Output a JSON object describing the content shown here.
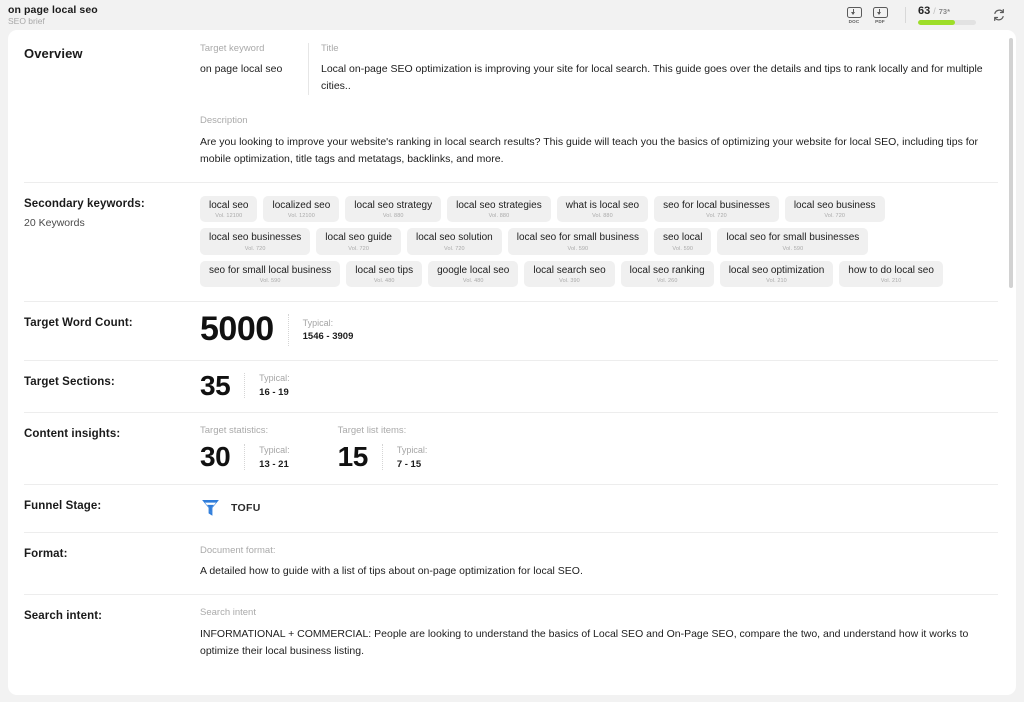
{
  "topbar": {
    "doc_title": "on page local seo",
    "doc_subtitle": "SEO brief",
    "export_doc": {
      "icon": "download-doc-icon",
      "tag": "DOC"
    },
    "export_pdf": {
      "icon": "download-pdf-icon",
      "tag": "PDF"
    },
    "score": {
      "current": "63",
      "separator": "/",
      "max": "73*",
      "progress_percent": 63,
      "bar_color": "#9ede29"
    },
    "refresh": {
      "icon": "refresh-icon"
    }
  },
  "sections": {
    "overview": {
      "label": "Overview",
      "target_keyword_label": "Target keyword",
      "target_keyword_value": "on page local seo",
      "title_label": "Title",
      "title_value": "Local on-page SEO optimization is improving your site for local search. This guide goes over the details and tips to rank locally and for multiple cities..",
      "description_label": "Description",
      "description_value": "Are you looking to improve your website's ranking in local search results? This guide will teach you the basics of optimizing your website for local SEO, including tips for mobile optimization, title tags and metatags, backlinks, and more."
    },
    "secondary_keywords": {
      "label": "Secondary keywords:",
      "count_text": "20 Keywords",
      "chips": [
        {
          "text": "local seo",
          "volume": "Vol. 12100"
        },
        {
          "text": "localized seo",
          "volume": "Vol. 12100"
        },
        {
          "text": "local seo strategy",
          "volume": "Vol. 880"
        },
        {
          "text": "local seo strategies",
          "volume": "Vol. 880"
        },
        {
          "text": "what is local seo",
          "volume": "Vol. 880"
        },
        {
          "text": "seo for local businesses",
          "volume": "Vol. 720"
        },
        {
          "text": "local seo business",
          "volume": "Vol. 720"
        },
        {
          "text": "local seo businesses",
          "volume": "Vol. 720"
        },
        {
          "text": "local seo guide",
          "volume": "Vol. 720"
        },
        {
          "text": "local seo solution",
          "volume": "Vol. 720"
        },
        {
          "text": "local seo for small business",
          "volume": "Vol. 590"
        },
        {
          "text": "seo local",
          "volume": "Vol. 590"
        },
        {
          "text": "local seo for small businesses",
          "volume": "Vol. 590"
        },
        {
          "text": "seo for small local business",
          "volume": "Vol. 590"
        },
        {
          "text": "local seo tips",
          "volume": "Vol. 480"
        },
        {
          "text": "google local seo",
          "volume": "Vol. 480"
        },
        {
          "text": "local search seo",
          "volume": "Vol. 390"
        },
        {
          "text": "local seo ranking",
          "volume": "Vol. 260"
        },
        {
          "text": "local seo optimization",
          "volume": "Vol. 210"
        },
        {
          "text": "how to do local seo",
          "volume": "Vol. 210"
        }
      ]
    },
    "target_word_count": {
      "label": "Target Word Count:",
      "value": "5000",
      "typical_label": "Typical:",
      "typical_value": "1546 - 3909"
    },
    "target_sections": {
      "label": "Target Sections:",
      "value": "35",
      "typical_label": "Typical:",
      "typical_value": "16 - 19"
    },
    "content_insights": {
      "label": "Content insights:",
      "statistics": {
        "head": "Target statistics:",
        "value": "30",
        "typical_label": "Typical:",
        "typical_value": "13 - 21"
      },
      "list_items": {
        "head": "Target list items:",
        "value": "15",
        "typical_label": "Typical:",
        "typical_value": "7 - 15"
      }
    },
    "funnel_stage": {
      "label": "Funnel Stage:",
      "icon": "funnel-icon",
      "icon_color": "#2f7ddb",
      "value": "TOFU"
    },
    "format": {
      "label": "Format:",
      "field_label": "Document format:",
      "value": "A detailed how to guide with a list of tips about on-page optimization for local SEO."
    },
    "search_intent": {
      "label": "Search intent:",
      "field_label": "Search intent",
      "value": "INFORMATIONAL + COMMERCIAL: People are looking to understand the basics of Local SEO and On-Page SEO, compare the two, and understand how it works to optimize their local business listing."
    }
  }
}
